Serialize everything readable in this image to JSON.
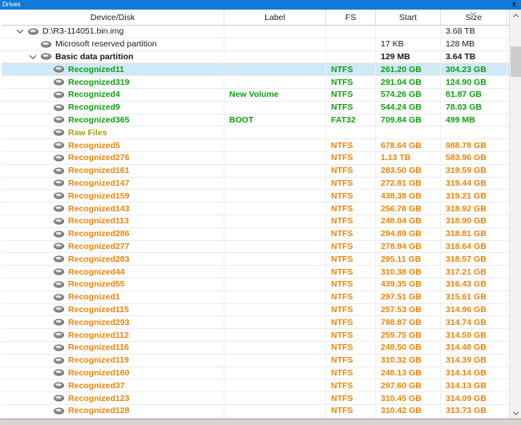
{
  "window": {
    "title": "Drives",
    "close_glyph": "x"
  },
  "colors": {
    "titlebar_bg": "#0f7bd7",
    "titlebar_text": "#ffffff",
    "close_x": "#3f0d0d",
    "selection_bg": "#cfe9f9",
    "black": "#1a1a1a",
    "green": "#0fa00f",
    "orange": "#ee8306",
    "olive": "#a3a309"
  },
  "table": {
    "columns": [
      {
        "label": "Device/Disk",
        "sorted": false
      },
      {
        "label": "Label",
        "sorted": false
      },
      {
        "label": "FS",
        "sorted": false
      },
      {
        "label": "Start",
        "sorted": false
      },
      {
        "label": "Size",
        "sorted": true
      }
    ],
    "rows": [
      {
        "device": "D:\\R3-114051.bin.img",
        "level": 0,
        "chevron": true,
        "color": "black",
        "bold": false,
        "selected": false,
        "label": "",
        "fs": "",
        "start": "",
        "size": "3.68 TB"
      },
      {
        "device": "Microsoft reserved partition",
        "level": 1,
        "chevron": false,
        "color": "black",
        "bold": false,
        "selected": false,
        "label": "",
        "fs": "",
        "start": "17 KB",
        "size": "128 MB"
      },
      {
        "device": "Basic data partition",
        "level": 1,
        "chevron": true,
        "color": "black",
        "bold": true,
        "selected": false,
        "label": "",
        "fs": "",
        "start": "129 MB",
        "size": "3.64 TB"
      },
      {
        "device": "Recognized11",
        "level": 2,
        "chevron": false,
        "color": "green",
        "bold": true,
        "selected": true,
        "label": "",
        "fs": "NTFS",
        "start": "261.20 GB",
        "size": "304.23 GB"
      },
      {
        "device": "Recognized319",
        "level": 2,
        "chevron": false,
        "color": "green",
        "bold": true,
        "selected": false,
        "label": "",
        "fs": "NTFS",
        "start": "291.04 GB",
        "size": "124.90 GB"
      },
      {
        "device": "Recognized4",
        "level": 2,
        "chevron": false,
        "color": "green",
        "bold": true,
        "selected": false,
        "label": "New Volume",
        "fs": "NTFS",
        "start": "574.26 GB",
        "size": "81.87 GB"
      },
      {
        "device": "Recognized9",
        "level": 2,
        "chevron": false,
        "color": "green",
        "bold": true,
        "selected": false,
        "label": "",
        "fs": "NTFS",
        "start": "544.24 GB",
        "size": "78.03 GB"
      },
      {
        "device": "Recognized365",
        "level": 2,
        "chevron": false,
        "color": "green",
        "bold": true,
        "selected": false,
        "label": "BOOT",
        "fs": "FAT32",
        "start": "709.84 GB",
        "size": "499 MB"
      },
      {
        "device": "Raw Files",
        "level": 2,
        "chevron": false,
        "color": "olive",
        "bold": true,
        "selected": false,
        "label": "",
        "fs": "",
        "start": "",
        "size": ""
      },
      {
        "device": "Recognized5",
        "level": 2,
        "chevron": false,
        "color": "orange",
        "bold": true,
        "selected": false,
        "label": "",
        "fs": "NTFS",
        "start": "678.64 GB",
        "size": "988.78 GB"
      },
      {
        "device": "Recognized276",
        "level": 2,
        "chevron": false,
        "color": "orange",
        "bold": true,
        "selected": false,
        "label": "",
        "fs": "NTFS",
        "start": "1.13 TB",
        "size": "583.96 GB"
      },
      {
        "device": "Recognized161",
        "level": 2,
        "chevron": false,
        "color": "orange",
        "bold": true,
        "selected": false,
        "label": "",
        "fs": "NTFS",
        "start": "283.50 GB",
        "size": "319.59 GB"
      },
      {
        "device": "Recognized147",
        "level": 2,
        "chevron": false,
        "color": "orange",
        "bold": true,
        "selected": false,
        "label": "",
        "fs": "NTFS",
        "start": "272.81 GB",
        "size": "319.44 GB"
      },
      {
        "device": "Recognized159",
        "level": 2,
        "chevron": false,
        "color": "orange",
        "bold": true,
        "selected": false,
        "label": "",
        "fs": "NTFS",
        "start": "438.38 GB",
        "size": "319.21 GB"
      },
      {
        "device": "Recognized143",
        "level": 2,
        "chevron": false,
        "color": "orange",
        "bold": true,
        "selected": false,
        "label": "",
        "fs": "NTFS",
        "start": "256.78 GB",
        "size": "318.92 GB"
      },
      {
        "device": "Recognized113",
        "level": 2,
        "chevron": false,
        "color": "orange",
        "bold": true,
        "selected": false,
        "label": "",
        "fs": "NTFS",
        "start": "248.04 GB",
        "size": "318.90 GB"
      },
      {
        "device": "Recognized286",
        "level": 2,
        "chevron": false,
        "color": "orange",
        "bold": true,
        "selected": false,
        "label": "",
        "fs": "NTFS",
        "start": "294.89 GB",
        "size": "318.81 GB"
      },
      {
        "device": "Recognized277",
        "level": 2,
        "chevron": false,
        "color": "orange",
        "bold": true,
        "selected": false,
        "label": "",
        "fs": "NTFS",
        "start": "278.94 GB",
        "size": "318.64 GB"
      },
      {
        "device": "Recognized283",
        "level": 2,
        "chevron": false,
        "color": "orange",
        "bold": true,
        "selected": false,
        "label": "",
        "fs": "NTFS",
        "start": "295.11 GB",
        "size": "318.57 GB"
      },
      {
        "device": "Recognized44",
        "level": 2,
        "chevron": false,
        "color": "orange",
        "bold": true,
        "selected": false,
        "label": "",
        "fs": "NTFS",
        "start": "310.38 GB",
        "size": "317.21 GB"
      },
      {
        "device": "Recognized55",
        "level": 2,
        "chevron": false,
        "color": "orange",
        "bold": true,
        "selected": false,
        "label": "",
        "fs": "NTFS",
        "start": "439.35 GB",
        "size": "316.43 GB"
      },
      {
        "device": "Recognized1",
        "level": 2,
        "chevron": false,
        "color": "orange",
        "bold": true,
        "selected": false,
        "label": "",
        "fs": "NTFS",
        "start": "297.51 GB",
        "size": "315.61 GB"
      },
      {
        "device": "Recognized115",
        "level": 2,
        "chevron": false,
        "color": "orange",
        "bold": true,
        "selected": false,
        "label": "",
        "fs": "NTFS",
        "start": "257.53 GB",
        "size": "314.96 GB"
      },
      {
        "device": "Recognized293",
        "level": 2,
        "chevron": false,
        "color": "orange",
        "bold": true,
        "selected": false,
        "label": "",
        "fs": "NTFS",
        "start": "798.87 GB",
        "size": "314.74 GB"
      },
      {
        "device": "Recognized112",
        "level": 2,
        "chevron": false,
        "color": "orange",
        "bold": true,
        "selected": false,
        "label": "",
        "fs": "NTFS",
        "start": "259.75 GB",
        "size": "314.59 GB"
      },
      {
        "device": "Recognized116",
        "level": 2,
        "chevron": false,
        "color": "orange",
        "bold": true,
        "selected": false,
        "label": "",
        "fs": "NTFS",
        "start": "248.50 GB",
        "size": "314.48 GB"
      },
      {
        "device": "Recognized119",
        "level": 2,
        "chevron": false,
        "color": "orange",
        "bold": true,
        "selected": false,
        "label": "",
        "fs": "NTFS",
        "start": "310.32 GB",
        "size": "314.39 GB"
      },
      {
        "device": "Recognized160",
        "level": 2,
        "chevron": false,
        "color": "orange",
        "bold": true,
        "selected": false,
        "label": "",
        "fs": "NTFS",
        "start": "248.13 GB",
        "size": "314.14 GB"
      },
      {
        "device": "Recognized37",
        "level": 2,
        "chevron": false,
        "color": "orange",
        "bold": true,
        "selected": false,
        "label": "",
        "fs": "NTFS",
        "start": "297.60 GB",
        "size": "314.13 GB"
      },
      {
        "device": "Recognized123",
        "level": 2,
        "chevron": false,
        "color": "orange",
        "bold": true,
        "selected": false,
        "label": "",
        "fs": "NTFS",
        "start": "310.45 GB",
        "size": "314.09 GB"
      },
      {
        "device": "Recognized128",
        "level": 2,
        "chevron": false,
        "color": "orange",
        "bold": true,
        "selected": false,
        "label": "",
        "fs": "NTFS",
        "start": "310.42 GB",
        "size": "313.73 GB"
      }
    ]
  }
}
